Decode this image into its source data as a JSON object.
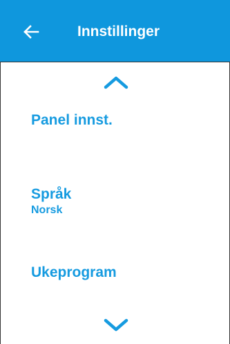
{
  "header": {
    "title": "Innstillinger",
    "back_icon": "arrow-left-icon",
    "background_color": "#0f97dd",
    "text_color": "#ffffff"
  },
  "scroll": {
    "up_icon": "chevron-up-icon",
    "down_icon": "chevron-down-icon"
  },
  "menu": {
    "accent_color": "#169be0",
    "items": [
      {
        "label": "Panel innst."
      },
      {
        "label": "Språk",
        "value": "Norsk"
      },
      {
        "label": "Ukeprogram"
      }
    ]
  }
}
